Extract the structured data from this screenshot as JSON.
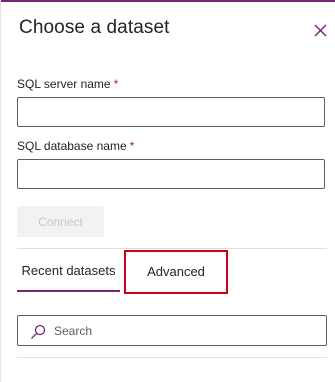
{
  "panel": {
    "title": "Choose a dataset"
  },
  "icons": {
    "close": "close-icon",
    "search": "search-icon"
  },
  "fields": {
    "server": {
      "label": "SQL server name",
      "required_mark": "*",
      "value": "",
      "placeholder": ""
    },
    "database": {
      "label": "SQL database name",
      "required_mark": "*",
      "value": "",
      "placeholder": ""
    }
  },
  "connect": {
    "label": "Connect"
  },
  "tabs": [
    {
      "label": "Recent datasets",
      "selected": true
    },
    {
      "label": "Advanced",
      "selected": false
    }
  ],
  "search": {
    "placeholder": "Search"
  },
  "colors": {
    "accent": "#742774",
    "highlight": "#d0021b"
  }
}
